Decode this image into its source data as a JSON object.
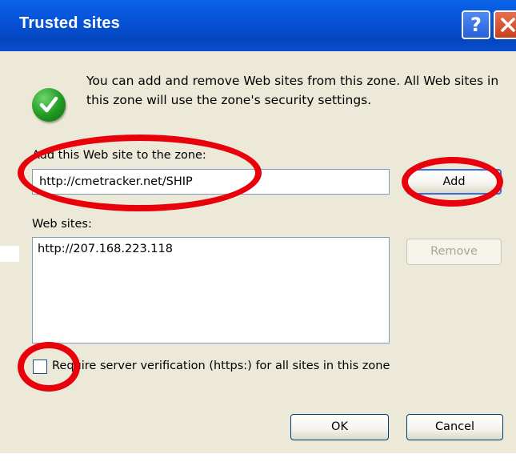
{
  "window": {
    "title": "Trusted sites",
    "help_glyph": "?",
    "close_icon": "close-x-icon"
  },
  "info": {
    "icon": "green-check-icon",
    "text": "You can add and remove Web sites from this zone. All Web sites in this zone will use the zone's security settings."
  },
  "add_site": {
    "label": "Add this Web site to the zone:",
    "value": "http://cmetracker.net/SHIP",
    "button_label": "Add"
  },
  "web_sites": {
    "label": "Web sites:",
    "items": [
      "http://207.168.223.118"
    ],
    "remove_label": "Remove"
  },
  "require_verification": {
    "label": "Require server verification (https:) for all sites in this zone",
    "checked": false
  },
  "footer": {
    "ok_label": "OK",
    "cancel_label": "Cancel"
  },
  "colors": {
    "titlebar": "#0553d6",
    "dialog_bg": "#ece9d8",
    "annotation": "#e8000b"
  }
}
